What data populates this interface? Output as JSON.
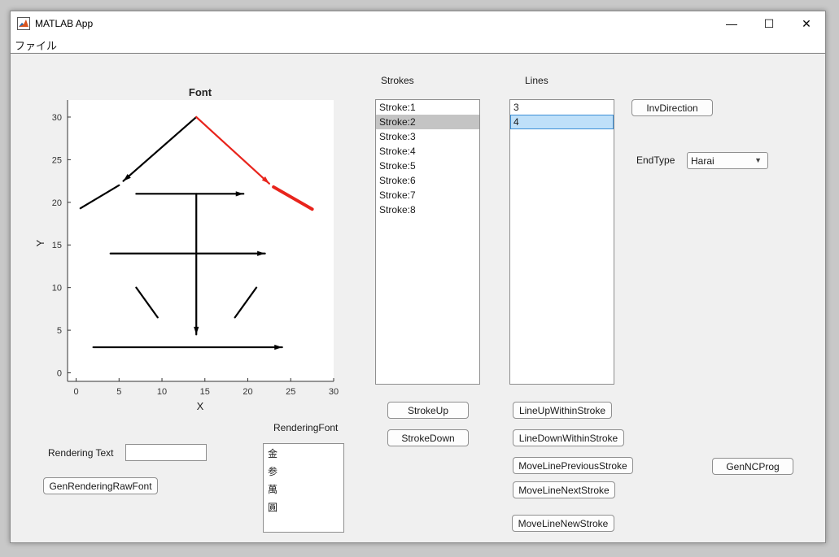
{
  "window": {
    "title": "MATLAB App",
    "minimize_glyph": "—",
    "maximize_glyph": "☐",
    "close_glyph": "✕"
  },
  "menu": {
    "file": "ファイル"
  },
  "plot": {
    "title": "Font",
    "xlabel": "X",
    "ylabel": "Y",
    "xticks": [
      "0",
      "5",
      "10",
      "15",
      "20",
      "25",
      "30"
    ],
    "yticks": [
      "0",
      "5",
      "10",
      "15",
      "20",
      "25",
      "30"
    ]
  },
  "chart_data": {
    "type": "line",
    "title": "Font",
    "xlabel": "X",
    "ylabel": "Y",
    "xlim": [
      -1,
      30
    ],
    "ylim": [
      -1,
      32
    ],
    "series": [
      {
        "color": "#000000",
        "arrow": true,
        "points": [
          [
            14,
            30
          ],
          [
            5.5,
            22.5
          ]
        ]
      },
      {
        "color": "#000000",
        "arrow": false,
        "points": [
          [
            5,
            22
          ],
          [
            0.5,
            19.3
          ]
        ]
      },
      {
        "color": "#e8241c",
        "arrow": true,
        "points": [
          [
            14,
            30
          ],
          [
            22.5,
            22.2
          ]
        ]
      },
      {
        "color": "#e8241c",
        "arrow": false,
        "points": [
          [
            23,
            21.8
          ],
          [
            27.5,
            19.2
          ]
        ]
      },
      {
        "color": "#000000",
        "arrow": true,
        "points": [
          [
            7,
            21
          ],
          [
            19.5,
            21
          ]
        ]
      },
      {
        "color": "#000000",
        "arrow": true,
        "points": [
          [
            14,
            21
          ],
          [
            14,
            4.5
          ]
        ]
      },
      {
        "color": "#000000",
        "arrow": true,
        "points": [
          [
            4,
            14
          ],
          [
            22,
            14
          ]
        ]
      },
      {
        "color": "#000000",
        "arrow": false,
        "points": [
          [
            7,
            10
          ],
          [
            9.5,
            6.5
          ]
        ]
      },
      {
        "color": "#000000",
        "arrow": false,
        "points": [
          [
            21,
            10
          ],
          [
            18.5,
            6.5
          ]
        ]
      },
      {
        "color": "#000000",
        "arrow": true,
        "points": [
          [
            2,
            3
          ],
          [
            24,
            3
          ]
        ]
      }
    ]
  },
  "strokes": {
    "label": "Strokes",
    "items": [
      "Stroke:1",
      "Stroke:2",
      "Stroke:3",
      "Stroke:4",
      "Stroke:5",
      "Stroke:6",
      "Stroke:7",
      "Stroke:8"
    ],
    "selected": "Stroke:2"
  },
  "lines": {
    "label": "Lines",
    "items": [
      "3",
      "4"
    ],
    "selected": "4"
  },
  "buttons": {
    "inv_direction": "InvDirection",
    "stroke_up": "StrokeUp",
    "stroke_down": "StrokeDown",
    "line_up": "LineUpWithinStroke",
    "line_down": "LineDownWithinStroke",
    "move_prev": "MoveLinePreviousStroke",
    "move_next": "MoveLineNextStroke",
    "move_new": "MoveLineNewStroke",
    "gen_nc": "GenNCProg",
    "gen_raw_font": "GenRenderingRawFont"
  },
  "end_type": {
    "label": "EndType",
    "value": "Harai"
  },
  "rendering": {
    "text_label": "Rendering Text",
    "text_value": "",
    "font_label": "RenderingFont",
    "font_items": [
      "金",
      "参",
      "萬",
      "圓"
    ]
  }
}
